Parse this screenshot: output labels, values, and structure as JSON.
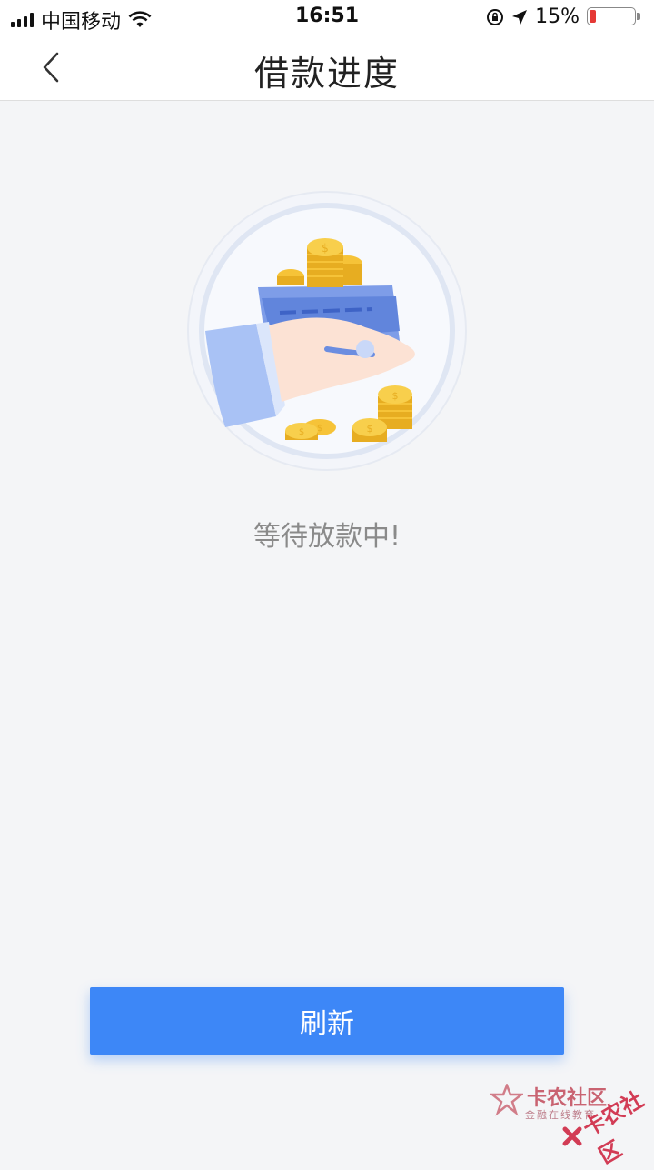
{
  "status_bar": {
    "carrier": "中国移动",
    "time": "16:51",
    "battery_percent": "15%",
    "battery_level": 0.15,
    "icons": [
      "signal-icon",
      "wifi-icon",
      "orientation-lock-icon",
      "location-icon",
      "battery-icon"
    ]
  },
  "nav": {
    "title": "借款进度",
    "back_icon": "back-chevron-icon"
  },
  "main": {
    "illustration": "hand-card-coins-illustration",
    "status_text": "等待放款中!"
  },
  "actions": {
    "refresh_label": "刷新"
  },
  "watermark": {
    "brand": "卡农社区",
    "tagline": "金融在线教育",
    "stamp": "卡农社区"
  },
  "colors": {
    "accent": "#3d87f7",
    "background": "#f4f5f7",
    "battery_low": "#e53935"
  }
}
